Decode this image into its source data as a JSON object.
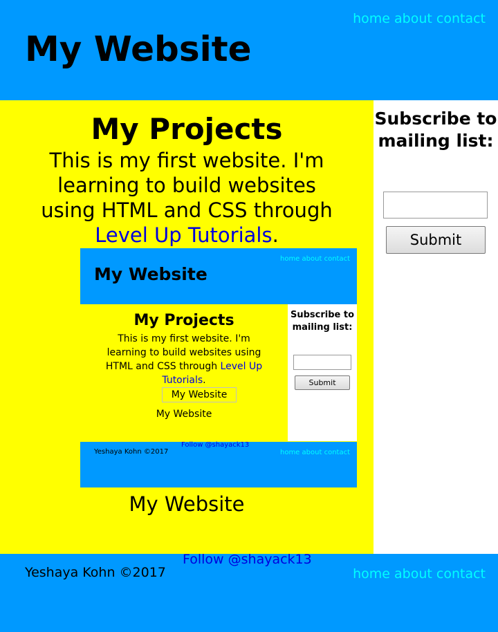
{
  "header": {
    "title": "My Website",
    "nav": [
      "home",
      "about",
      "contact"
    ]
  },
  "projects": {
    "title": "My Projects",
    "text_before": "This is my first website. I'm learning to build websites using HTML and CSS through ",
    "link": "Level Up Tutorials",
    "text_after": "."
  },
  "subscribe": {
    "title": "Subscribe to mailing list:",
    "email_value": "",
    "submit_label": "Submit"
  },
  "embedded": {
    "header": {
      "title": "My Website",
      "nav": [
        "home",
        "about",
        "contact"
      ]
    },
    "projects": {
      "title": "My Projects",
      "text_before": "This is my first website. I'm learning to build websites using HTML and CSS through ",
      "link": "Level Up Tutorials",
      "text_after": "."
    },
    "image_alt": "My Website",
    "caption": "My Website",
    "subscribe": {
      "title": "Subscribe to mailing list:",
      "submit_label": "Submit"
    },
    "footer": {
      "copyright": "Yeshaya Kohn ©2017",
      "follow": "Follow @shayack13",
      "nav": [
        "home",
        "about",
        "contact"
      ]
    }
  },
  "caption": "My Website",
  "footer": {
    "copyright": "Yeshaya Kohn ©2017",
    "follow": "Follow @shayack13",
    "nav": [
      "home",
      "about",
      "contact"
    ]
  },
  "colors": {
    "header_bg": "#0099ff",
    "main_bg": "#ffff00",
    "nav_link": "#00ffff",
    "link": "#0000dd"
  }
}
